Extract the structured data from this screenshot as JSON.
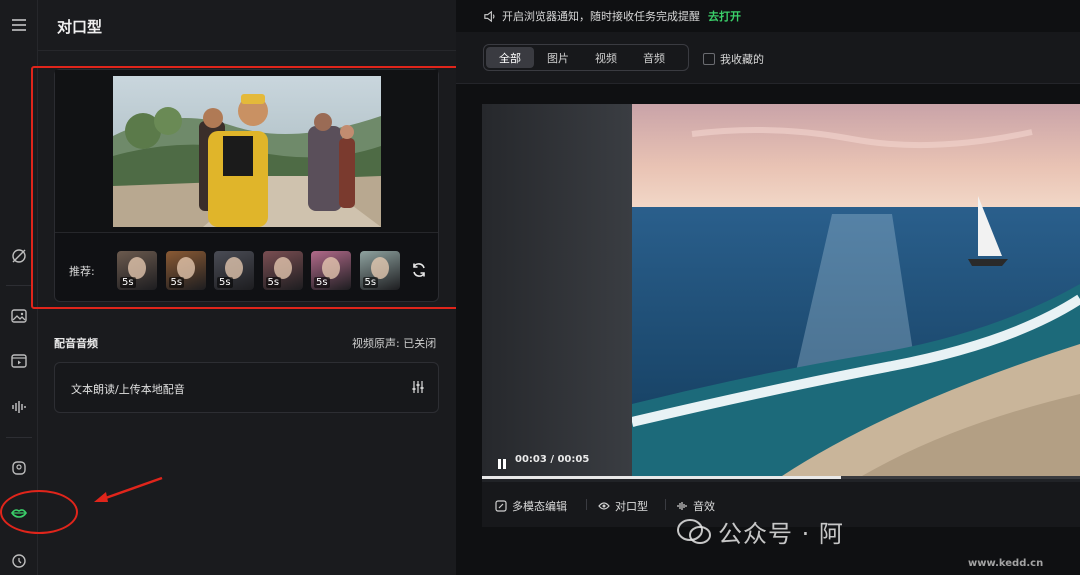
{
  "panel": {
    "title": "对口型"
  },
  "recommend": {
    "label": "推荐:",
    "thumbs": [
      {
        "duration": "5s",
        "bg": "#6b5a4e"
      },
      {
        "duration": "5s",
        "bg": "#8a5a34"
      },
      {
        "duration": "5s",
        "bg": "#4a4c55"
      },
      {
        "duration": "5s",
        "bg": "#7a4e52"
      },
      {
        "duration": "5s",
        "bg": "#b26a8a"
      },
      {
        "duration": "5s",
        "bg": "#8fa3a0"
      }
    ]
  },
  "audio": {
    "section_title": "配音音频",
    "original_sound": "视频原声: 已关闭",
    "option_text": "文本朗读/上传本地配音"
  },
  "notice": {
    "text": "开启浏览器通知，随时接收任务完成提醒",
    "action": "去打开"
  },
  "filters": {
    "tabs": [
      "全部",
      "图片",
      "视频",
      "音频"
    ],
    "active": 0,
    "favorites_label": "我收藏的"
  },
  "player": {
    "time": "00:03 / 00:05",
    "progress": 0.6
  },
  "toolbar": {
    "multimodal": "多模态编辑",
    "lipsync": "对口型",
    "sfx": "音效"
  },
  "watermark": {
    "text": "公众号 · 阿",
    "url": "www.kedd.cn"
  },
  "colors": {
    "accent_green": "#3bd06a",
    "annotation_red": "#e0251b"
  }
}
